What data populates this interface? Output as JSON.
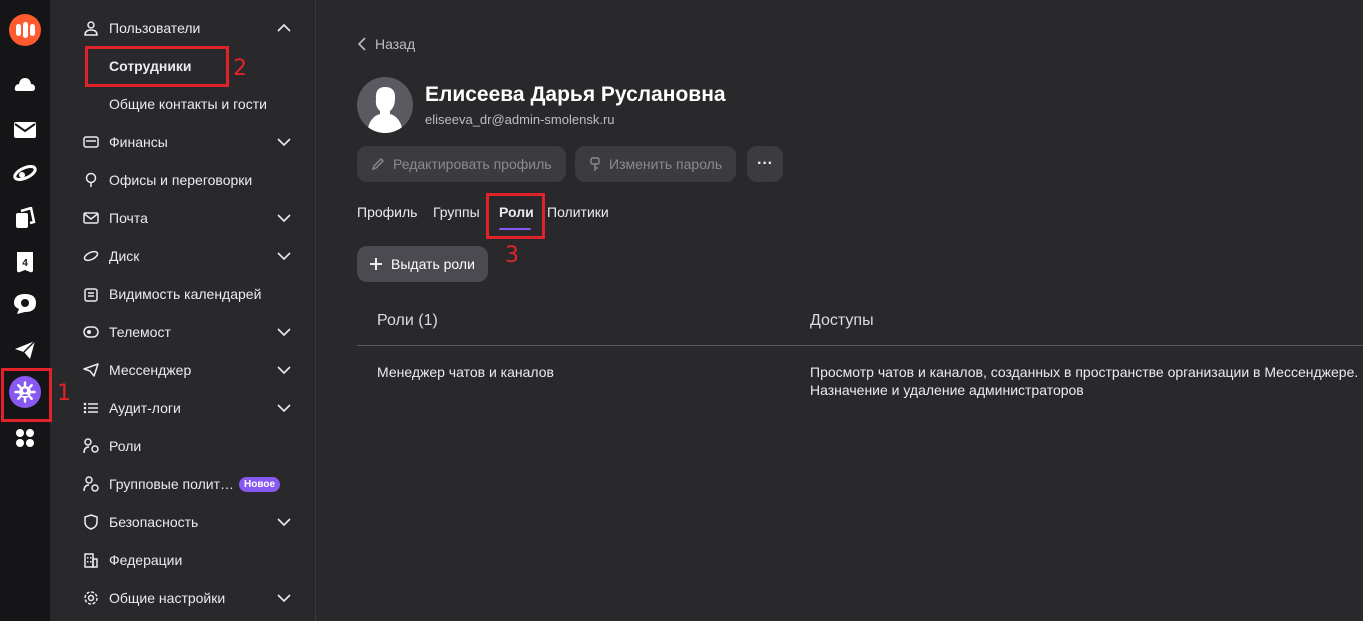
{
  "rail": {
    "icons": [
      "logo-icon",
      "cloud-icon",
      "mail-icon",
      "disk-icon",
      "docs-icon",
      "calendar-icon",
      "telemost-icon",
      "messenger-icon",
      "admin-icon",
      "apps-icon"
    ],
    "calendar_day": "4",
    "accent": "#8759f2",
    "logo_color": "#ff5a30"
  },
  "sidebar": {
    "users": "Пользователи",
    "employees": "Сотрудники",
    "contacts": "Общие контакты и гости",
    "finance": "Финансы",
    "offices": "Офисы и переговорки",
    "mail": "Почта",
    "disk": "Диск",
    "calendar_visibility": "Видимость календарей",
    "telemost": "Телемост",
    "messenger": "Мессенджер",
    "audit": "Аудит-логи",
    "roles": "Роли",
    "group_policies": "Групповые полит…",
    "new_badge": "Новое",
    "security": "Безопасность",
    "federations": "Федерации",
    "general_settings": "Общие настройки"
  },
  "main": {
    "back": "Назад",
    "user_name": "Елисеева Дарья Руслановна",
    "user_email": "eliseeva_dr@admin-smolensk.ru",
    "edit_profile": "Редактировать профиль",
    "change_password": "Изменить пароль",
    "more": "···",
    "tabs": {
      "profile": "Профиль",
      "groups": "Группы",
      "roles": "Роли",
      "policies": "Политики"
    },
    "grant_roles": "Выдать роли",
    "table": {
      "col_roles": "Роли (1)",
      "col_access": "Доступы",
      "row_role": "Менеджер чатов и каналов",
      "row_access_1": "Просмотр чатов и каналов, созданных в пространстве организации в Мессенджере.",
      "row_access_2": "Назначение и удаление администраторов"
    }
  },
  "annotations": {
    "n1": "1",
    "n2": "2",
    "n3": "3",
    "color": "#e0232b"
  }
}
